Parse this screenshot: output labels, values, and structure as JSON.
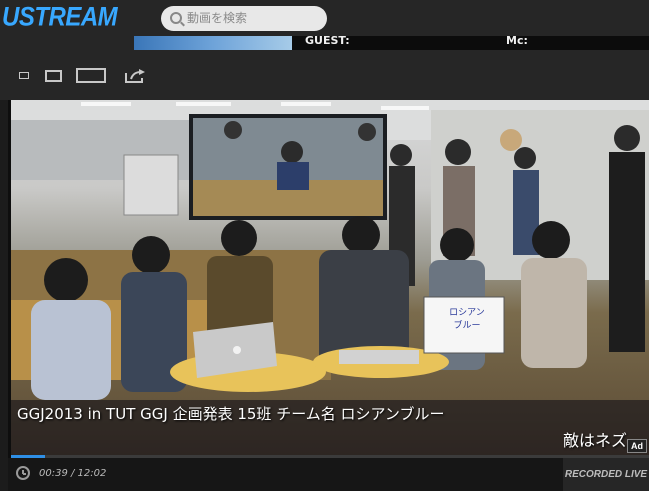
{
  "header": {
    "logo": "USTREAM",
    "search_placeholder": "動画を検索"
  },
  "banner": {
    "text1": "GUEST:",
    "text2": "Mc:"
  },
  "toolbar": {
    "size_icons": [
      "player-size-small-icon",
      "player-size-medium-icon",
      "player-size-large-icon"
    ],
    "share_icon": "share-icon"
  },
  "video": {
    "caption_line1": "GGJ2013 in TUT GGJ 企画発表 15班 チーム名 ロシアンブルー",
    "caption_line2": "敵はネズ",
    "ad_badge": "Ad",
    "sign_text": "ロシアン\nブルー"
  },
  "controls": {
    "time": "00:39 / 12:02",
    "progress": 0.054,
    "status": "RECORDED LIVE"
  },
  "colors": {
    "brand_blue": "#38a8ff",
    "progress_blue": "#2f8fe6",
    "background": "#262626"
  }
}
